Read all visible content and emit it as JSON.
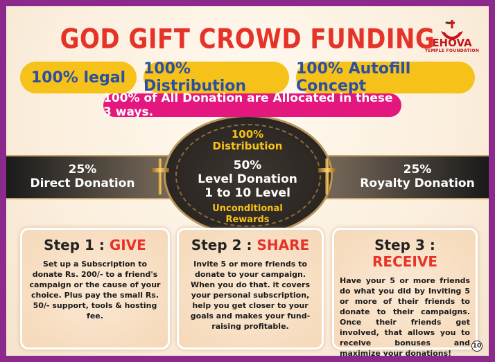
{
  "title": "GOD GIFT CROWD FUNDING",
  "logo": {
    "name": "EHOVA",
    "sub": "TEMPLE FOUNDATION"
  },
  "pills": [
    "100% legal",
    "100% Distribution",
    "100% Autofill Concept"
  ],
  "allocation_banner": "100% of All Donation are Allocated in these 3 ways.",
  "center": {
    "top_line1": "100%",
    "top_line2": "Distribution",
    "bottom_line1": "Unconditional",
    "bottom_line2": "Rewards"
  },
  "band": {
    "left_percent": "25%",
    "left_label": "Direct Donation",
    "mid_percent": "50%",
    "mid_label": "Level Donation",
    "mid_sub": "1 to 10 Level",
    "right_percent": "25%",
    "right_label": "Royalty Donation"
  },
  "steps": [
    {
      "prefix": "Step 1 : ",
      "word": "GIVE",
      "text": "Set up a Subscription to donate Rs. 200/- to a friend's campaign or the cause of your choice. Plus pay the small Rs. 50/- support, tools & hosting fee."
    },
    {
      "prefix": "Step 2 : ",
      "word": "SHARE",
      "text": "Invite 5 or more friends to donate to your campaign. When you do that. it covers your personal subscription, help you get closer to your goals and makes your fund-raising profitable."
    },
    {
      "prefix": "Step 3 : ",
      "word": "RECEIVE",
      "text": "Have your 5 or more friends do what you did by Inviting 5 or more of their friends to donate to their campaigns. Once their friends get involved, that allows you to receive bonuses and maximize your donations!"
    }
  ],
  "page_number": "10",
  "colors": {
    "title": "#e5332a",
    "pill": "#f6c21a",
    "pill_text": "#2a4fa3",
    "banner": "#e3177d",
    "frame": "#8b2a8c"
  },
  "icons": [
    "cross-icon",
    "dove-hands-icon"
  ]
}
